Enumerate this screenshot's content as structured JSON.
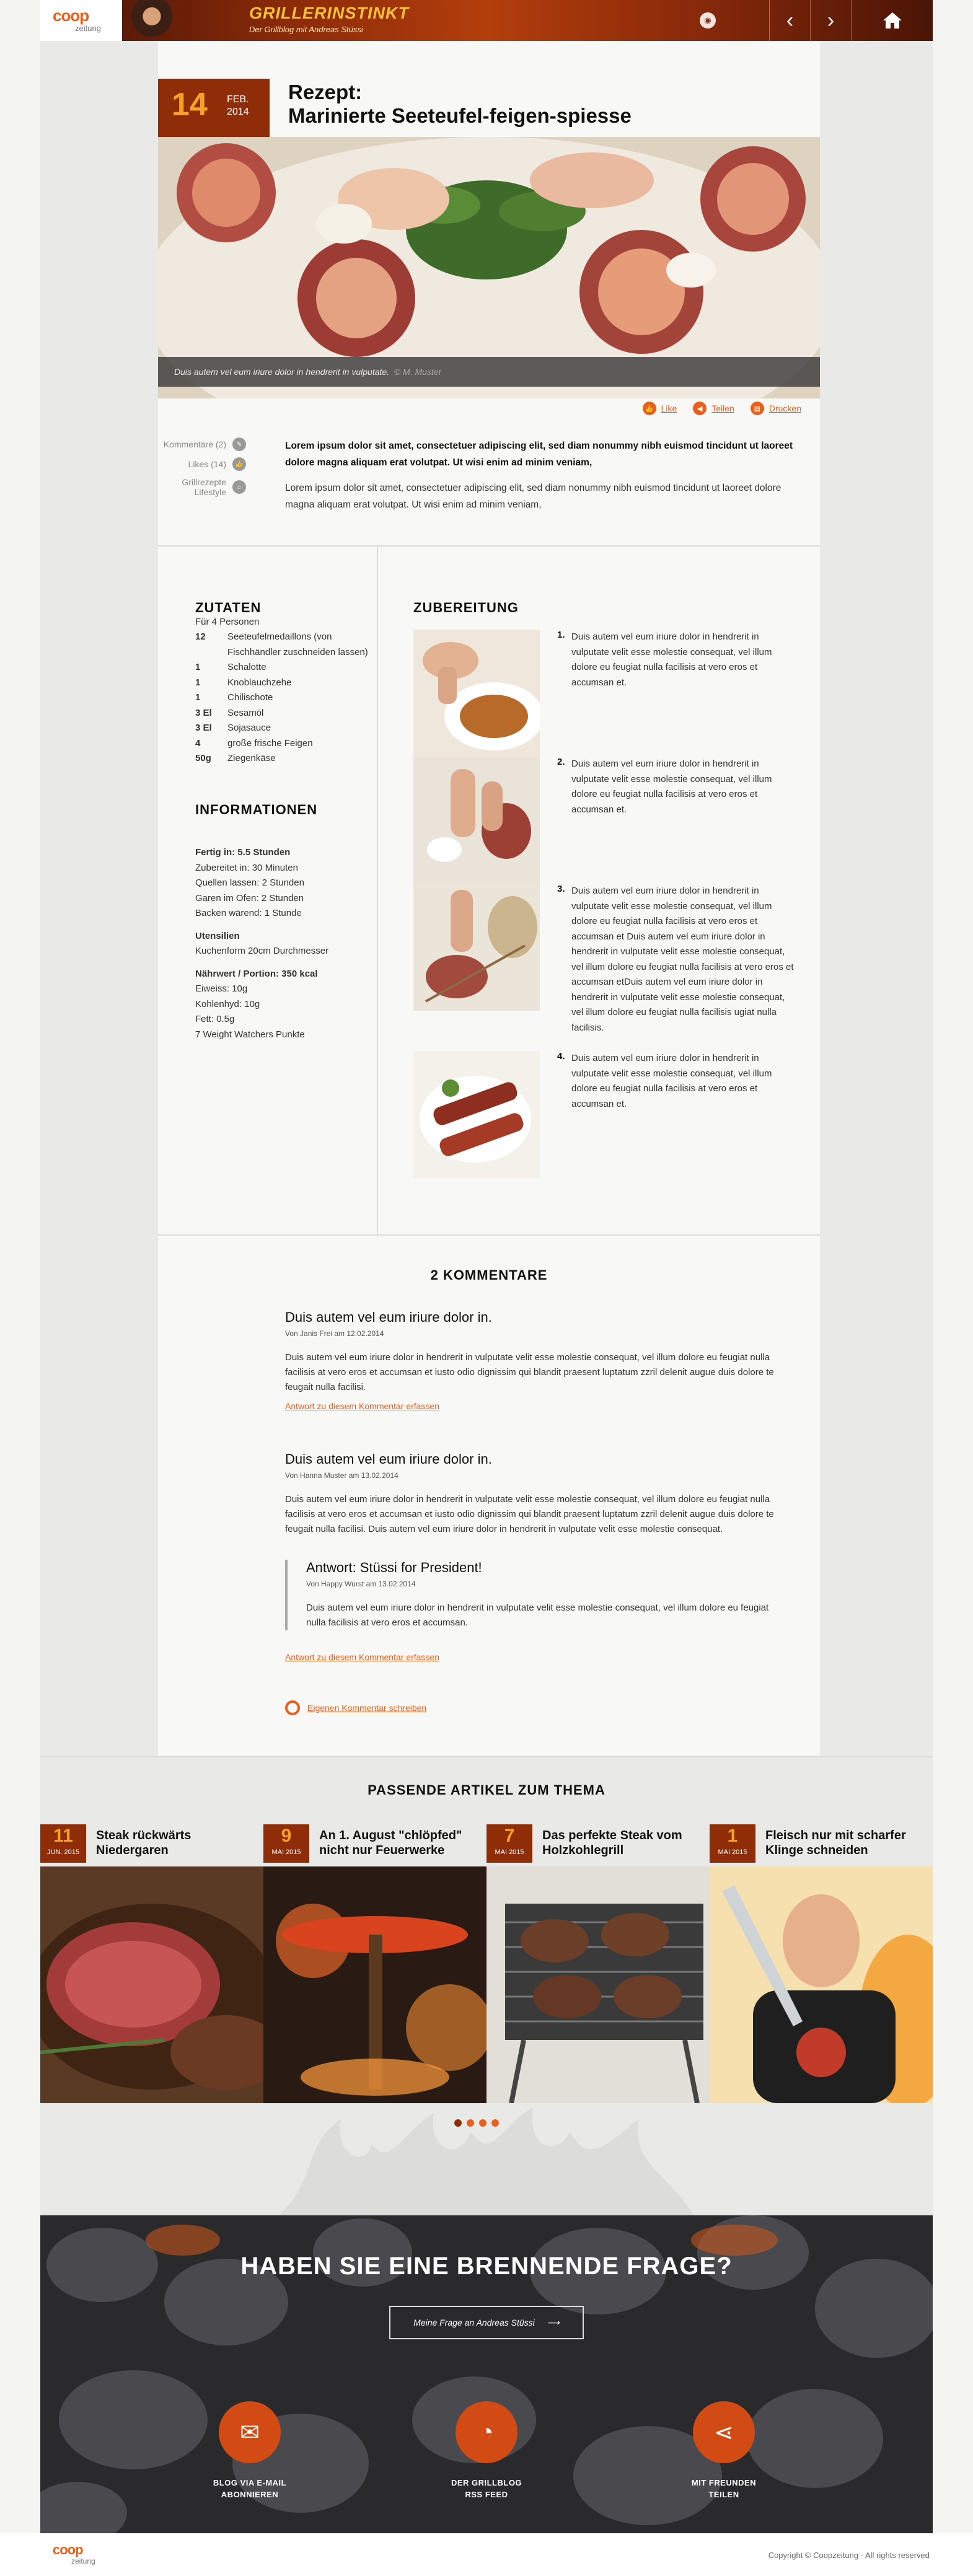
{
  "header": {
    "logo": "coop",
    "logo_sub": "zeitung",
    "blog_title": "GRILLERINSTINKT",
    "blog_subtitle": "Der Grillblog mit Andreas Stüssi",
    "nav": [
      "prev-icon",
      "next-icon",
      "home-icon"
    ]
  },
  "article": {
    "date_day": "14",
    "date_month": "FEB.",
    "date_year": "2014",
    "title_line1": "Rezept:",
    "title_line2": "Marinierte Seeteufel-feigen-spiesse",
    "caption": "Duis autem vel eum iriure dolor in hendrerit in vulputate.",
    "caption_credit": "© M. Muster",
    "actions": {
      "like": "Like",
      "share": "Teilen",
      "print": "Drucken"
    },
    "meta": {
      "comments": "Kommentare (2)",
      "likes": "Likes (14)",
      "category_1": "Grillrezepte",
      "category_2": "Lifestyle"
    },
    "lead": "Lorem ipsum dolor sit amet, consectetuer adipiscing elit, sed diam nonummy nibh euismod tincidunt ut laoreet dolore magna aliquam erat volutpat. Ut wisi enim ad minim veniam,",
    "body": "Lorem ipsum dolor sit amet, consectetuer adipiscing elit, sed diam nonummy nibh euismod tincidunt ut laoreet dolore magna aliquam erat volutpat. Ut wisi enim ad minim veniam,"
  },
  "ingredients": {
    "heading": "ZUTATEN",
    "servings": "Für 4 Personen",
    "items": [
      {
        "q": "12",
        "t": "Seeteufelmedaillons (von Fischhändler zuschneiden lassen)"
      },
      {
        "q": "1",
        "t": "Schalotte"
      },
      {
        "q": "1",
        "t": "Knoblauchzehe"
      },
      {
        "q": "1",
        "t": "Chilischote"
      },
      {
        "q": "3 El",
        "t": "Sesamöl"
      },
      {
        "q": "3 El",
        "t": "Sojasauce"
      },
      {
        "q": "4",
        "t": "große frische Feigen"
      },
      {
        "q": "50g",
        "t": "Ziegenkäse"
      }
    ]
  },
  "info": {
    "heading": "INFORMATIONEN",
    "ready": "Fertig in: 5.5 Stunden",
    "times": [
      "Zubereitet in: 30 Minuten",
      "Quellen lassen: 2 Stunden",
      "Garen im Ofen: 2 Stunden",
      "Backen wärend: 1 Stunde"
    ],
    "tools_h": "Utensilien",
    "tools": "Kuchenform 20cm Durchmesser",
    "nutri_h": "Nährwert / Portion: 350 kcal",
    "nutri": [
      "Eiweiss: 10g",
      "Kohlenhyd: 10g",
      "Fett: 0.5g",
      "7 Weight Watchers Punkte"
    ]
  },
  "preparation": {
    "heading": "ZUBEREITUNG",
    "steps": [
      {
        "n": "1.",
        "t": "Duis autem vel eum iriure dolor in hendrerit in vulputate velit esse molestie consequat, vel illum dolore eu feugiat nulla facilisis at vero eros et accumsan et."
      },
      {
        "n": "2.",
        "t": "Duis autem vel eum iriure dolor in hendrerit in vulputate velit esse molestie consequat, vel illum dolore eu feugiat nulla facilisis at vero eros et accumsan et."
      },
      {
        "n": "3.",
        "t": "Duis autem vel eum iriure dolor in hendrerit in vulputate velit esse molestie consequat, vel illum dolore eu feugiat nulla facilisis at vero eros et accumsan et Duis autem vel eum iriure dolor in hendrerit in vulputate velit esse molestie consequat, vel illum dolore eu feugiat nulla facilisis at vero eros et accumsan etDuis autem vel eum iriure dolor in hendrerit in vulputate velit esse molestie consequat, vel illum dolore eu feugiat nulla facilisis ugiat nulla facilisis."
      },
      {
        "n": "4.",
        "t": "Duis autem vel eum iriure dolor in hendrerit in vulputate velit esse molestie consequat, vel illum dolore eu feugiat nulla facilisis at vero eros et accumsan et."
      }
    ]
  },
  "comments": {
    "heading": "2 KOMMENTARE",
    "items": [
      {
        "title": "Duis autem vel eum iriure dolor in.",
        "by": "Von Janis Frei am 12.02.2014",
        "text": "Duis autem vel eum iriure dolor in hendrerit in vulputate velit esse molestie consequat, vel illum dolore eu feugiat nulla facilisis at vero eros et accumsan et iusto odio dignissim qui blandit praesent luptatum zzril delenit augue duis dolore te feugait nulla facilisi.",
        "reply_link": "Antwort zu diesem Kommentar erfassen"
      },
      {
        "title": "Duis autem vel eum iriure dolor in.",
        "by": "Von Hanna Muster am 13.02.2014",
        "text": "Duis autem vel eum iriure dolor in hendrerit in vulputate velit esse molestie consequat, vel illum dolore eu feugiat nulla facilisis at vero eros et accumsan et iusto odio dignissim qui blandit praesent luptatum zzril delenit augue duis dolore te feugait nulla facilisi. Duis autem vel eum iriure dolor in hendrerit in vulputate velit esse molestie consequat.",
        "reply_link": "Antwort zu diesem Kommentar erfassen"
      }
    ],
    "reply": {
      "title": "Antwort: Stüssi for President!",
      "by": "Von Happy Wurst am 13.02.2014",
      "text": "Duis autem vel eum iriure dolor in hendrerit in vulputate velit esse molestie consequat, vel illum dolore eu feugiat nulla facilisis at vero eros et accumsan."
    },
    "write": "Eigenen Kommentar schreiben"
  },
  "related": {
    "heading": "PASSENDE ARTIKEL ZUM THEMA",
    "items": [
      {
        "d": "11",
        "m": "JUN. 2015",
        "t": "Steak rückwärts Niedergaren"
      },
      {
        "d": "9",
        "m": "MAI 2015",
        "t": "An 1. August \"chlöpfed\" nicht nur Feuerwerke"
      },
      {
        "d": "7",
        "m": "MAI 2015",
        "t": "Das perfekte Steak vom Holzkohlegrill"
      },
      {
        "d": "1",
        "m": "MAI 2015",
        "t": "Fleisch nur mit scharfer Klinge schneiden"
      }
    ],
    "dots": 4,
    "active_dot": 1
  },
  "cta": {
    "heading": "HABEN SIE EINE BRENNENDE FRAGE?",
    "button": "Meine Frage an Andreas Stüssi",
    "items": [
      {
        "icon": "mail-icon",
        "l1": "BLOG VIA E-MAIL",
        "l2": "ABONNIEREN"
      },
      {
        "icon": "rss-icon",
        "l1": "DER GRILLBLOG",
        "l2": "RSS FEED"
      },
      {
        "icon": "share-icon",
        "l1": "MIT FREUNDEN",
        "l2": "TEILEN"
      }
    ]
  },
  "footer": {
    "logo": "coop",
    "logo_sub": "zeitung",
    "copyright": "Copyright © Coopzeitung - All rights reserved"
  },
  "colors": {
    "accent": "#e8601b",
    "brand_dark": "#8e2d07",
    "date_gold": "#f4a226"
  }
}
